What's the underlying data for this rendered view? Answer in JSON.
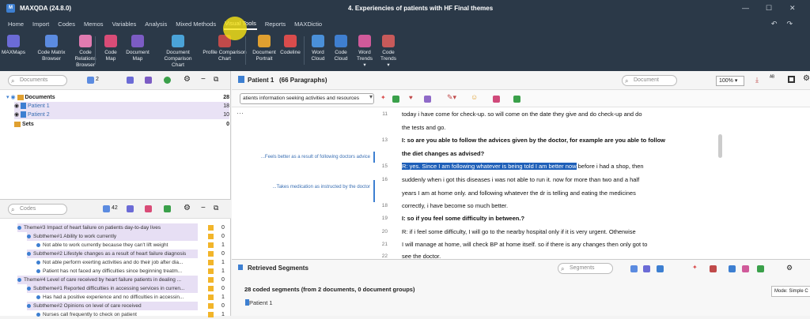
{
  "app": {
    "title": "MAXQDA (24.8.0)",
    "document_title": "4. Experiencies of patients with HF Final themes"
  },
  "menu": [
    "Home",
    "Import",
    "Codes",
    "Memos",
    "Variables",
    "Analysis",
    "Mixed Methods",
    "Visual Tools",
    "Reports",
    "MAXDictio"
  ],
  "ribbon": [
    {
      "label1": "MAXMaps",
      "label2": "",
      "icon_color": "#6b6bd6",
      "icon": "maxmaps-icon"
    },
    {
      "label1": "Code Matrix",
      "label2": "Browser",
      "icon_color": "#5b8be0",
      "icon": "code-matrix-icon"
    },
    {
      "label1": "Code Relations",
      "label2": "Browser",
      "icon_color": "#e07bb0",
      "icon": "code-relations-icon"
    },
    {
      "label1": "Code",
      "label2": "Map",
      "icon_color": "#d94c77",
      "icon": "code-map-icon"
    },
    {
      "label1": "Document",
      "label2": "Map",
      "icon_color": "#7c5cc4",
      "icon": "document-map-icon"
    },
    {
      "label1": "Document",
      "label2": "Comparison Chart",
      "icon_color": "#4aa3d8",
      "icon": "document-comparison-icon"
    },
    {
      "label1": "Profile Comparison",
      "label2": "Chart",
      "icon_color": "#c04a4a",
      "icon": "profile-comparison-icon"
    },
    {
      "label1": "Document",
      "label2": "Portrait",
      "icon_color": "#e0a030",
      "icon": "document-portrait-icon"
    },
    {
      "label1": "Codeline",
      "label2": "",
      "icon_color": "#d94c4c",
      "icon": "codeline-icon"
    },
    {
      "label1": "Word",
      "label2": "Cloud",
      "icon_color": "#4a90d9",
      "icon": "word-cloud-icon"
    },
    {
      "label1": "Code",
      "label2": "Cloud",
      "icon_color": "#3f7fd0",
      "icon": "code-cloud-icon"
    },
    {
      "label1": "Word",
      "label2": "Trends ▾",
      "icon_color": "#d05a9a",
      "icon": "word-trends-icon"
    },
    {
      "label1": "Code",
      "label2": "Trends ▾",
      "icon_color": "#c85a5a",
      "icon": "code-trends-icon"
    }
  ],
  "documents_panel": {
    "search_placeholder": "Documents",
    "filter_count": "2",
    "rows": [
      {
        "label": "Documents",
        "count": "28"
      },
      {
        "label": "Patient 1",
        "count": "18"
      },
      {
        "label": "Patient 2",
        "count": "10"
      },
      {
        "label": "Sets",
        "count": "0"
      }
    ]
  },
  "codes_panel": {
    "search_placeholder": "Codes",
    "filter_count": "42",
    "rows": [
      {
        "label": "Theme#3 Impact of heart failure on patients day-to-day lives",
        "count": "0"
      },
      {
        "label": "Subtheme#1 Ability to work currently",
        "count": "0"
      },
      {
        "label": "Not able to work currently because they can't lift weight",
        "count": "1"
      },
      {
        "label": "Subtheme#2 Lifestyle changes as a result of heart failure diagnosis",
        "count": "0"
      },
      {
        "label": "Not able perform exerting activities and do their job after dia...",
        "count": "1"
      },
      {
        "label": "Patient has not faced any difficulties since beginning treatm...",
        "count": "1"
      },
      {
        "label": "Theme#4 Level of care received  by heart failure patients in  dealing ...",
        "count": "0"
      },
      {
        "label": "Subtheme#1 Reported difficulties in accessing services in curren...",
        "count": "0"
      },
      {
        "label": "Has had a positive experience and no difficulties in accessin...",
        "count": "1"
      },
      {
        "label": "Subtheme#2 Opinions on level of care received",
        "count": "0"
      },
      {
        "label": "Nurses call frequently to check on patient",
        "count": "1"
      }
    ]
  },
  "document_view": {
    "title": "Patient 1",
    "paragraphs": "(66 Paragraphs)",
    "zoom": "100%",
    "search_placeholder": "Document",
    "code_combo": "atients information seeking activities and resources",
    "memos": [
      "...Feels better as a result of following doctors advice",
      "...Takes medication as instructed by the doctor"
    ],
    "lines": [
      {
        "n": "11",
        "text": "today i have come for check-up. so will come on the date they give and do check-up and do",
        "bold": false
      },
      {
        "n": "",
        "text": "the tests and go.",
        "bold": false
      },
      {
        "n": "13",
        "text": "I: so are you able to follow the advices given by the doctor, for example are you able to follow",
        "bold": true
      },
      {
        "n": "",
        "text": "the diet changes as advised?",
        "bold": true
      },
      {
        "n": "15",
        "text_sel": "R: yes. Since I am following whatever is being told I am better now",
        "text_rest": " before i had a shop, then",
        "bold": false
      },
      {
        "n": "16",
        "text": "suddenly when i got this diseases i was not able to run it. now for more than two and a half",
        "bold": false
      },
      {
        "n": "",
        "text": "years I am at home only. and following whatever the dr is telling and eating the medicines",
        "bold": false
      },
      {
        "n": "18",
        "text": "correctly, i have become so much better.",
        "bold": false
      },
      {
        "n": "19",
        "text": "I: so if you feel some difficulty in between.?",
        "bold": true
      },
      {
        "n": "20",
        "text": "R: if i feel some difficulty, I will go to the nearby hospital only if it is very urgent. Otherwise",
        "bold": false
      },
      {
        "n": "21",
        "text": "I will manage at home, will check BP at home itself. so if there is any changes then only got to",
        "bold": false
      },
      {
        "n": "22",
        "text": "see the doctor.",
        "bold": false
      }
    ]
  },
  "retrieved": {
    "title": "Retrieved Segments",
    "search_placeholder": "Segments",
    "summary": "28 coded segments (from 2 documents, 0 document groups)",
    "patient": "Patient 1",
    "mode": "Mode: Simple C"
  }
}
